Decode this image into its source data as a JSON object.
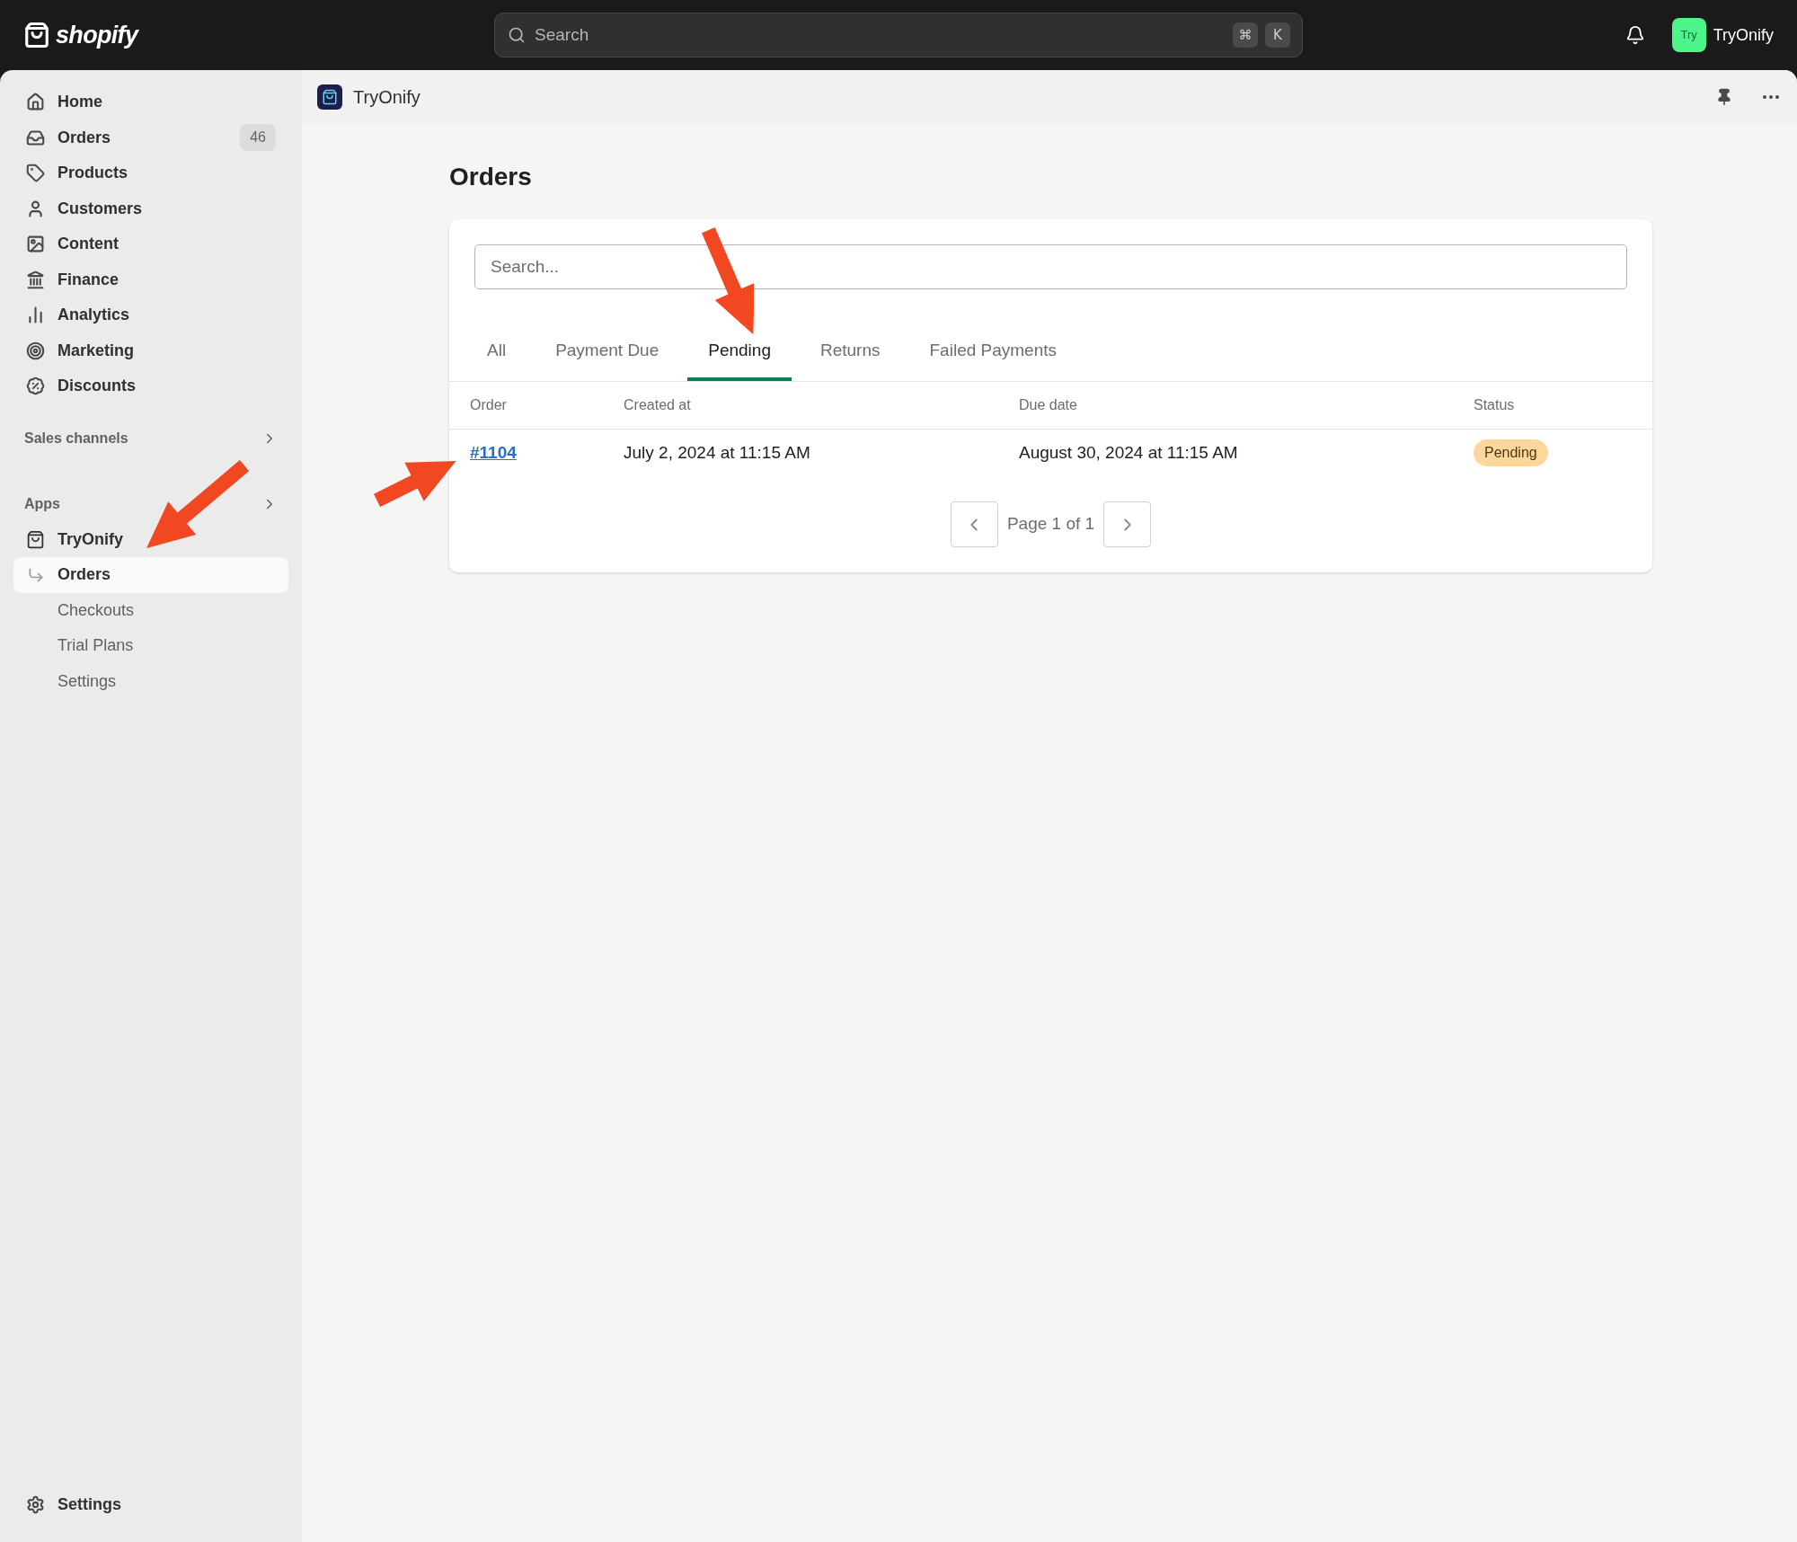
{
  "topbar": {
    "logo_text": "shopify",
    "search": {
      "placeholder": "Search",
      "keys": [
        "⌘",
        "K"
      ]
    },
    "account": {
      "avatar_text": "Try",
      "name": "TryOnify"
    }
  },
  "sidebar": {
    "items": [
      {
        "label": "Home",
        "selected": false
      },
      {
        "label": "Orders",
        "badge": "46",
        "selected": false
      },
      {
        "label": "Products",
        "selected": false
      },
      {
        "label": "Customers",
        "selected": false
      },
      {
        "label": "Content",
        "selected": false
      },
      {
        "label": "Finance",
        "selected": false
      },
      {
        "label": "Analytics",
        "selected": false
      },
      {
        "label": "Marketing",
        "selected": false
      },
      {
        "label": "Discounts",
        "selected": false
      }
    ],
    "sales_channels": "Sales channels",
    "apps": "Apps",
    "app": {
      "name": "TryOnify",
      "children": [
        {
          "label": "Orders",
          "selected": true
        },
        {
          "label": "Checkouts",
          "selected": false
        },
        {
          "label": "Trial Plans",
          "selected": false
        },
        {
          "label": "Settings",
          "selected": false
        }
      ]
    },
    "settings": "Settings"
  },
  "page_header": {
    "title": "TryOnify"
  },
  "heading": "Orders",
  "card": {
    "search": {
      "placeholder": "Search..."
    },
    "tabs": [
      {
        "label": "All",
        "selected": false
      },
      {
        "label": "Payment Due",
        "selected": false
      },
      {
        "label": "Pending",
        "selected": true
      },
      {
        "label": "Returns",
        "selected": false
      },
      {
        "label": "Failed Payments",
        "selected": false
      }
    ],
    "table": {
      "columns": [
        "Order",
        "Created at",
        "Due date",
        "Status"
      ],
      "rows": [
        {
          "order": "#1104",
          "created_at": "July 2, 2024 at 11:15 AM",
          "due_date": "August 30, 2024 at 11:15 AM",
          "status": "Pending"
        }
      ]
    },
    "pagination": {
      "label": "Page 1 of 1"
    }
  }
}
